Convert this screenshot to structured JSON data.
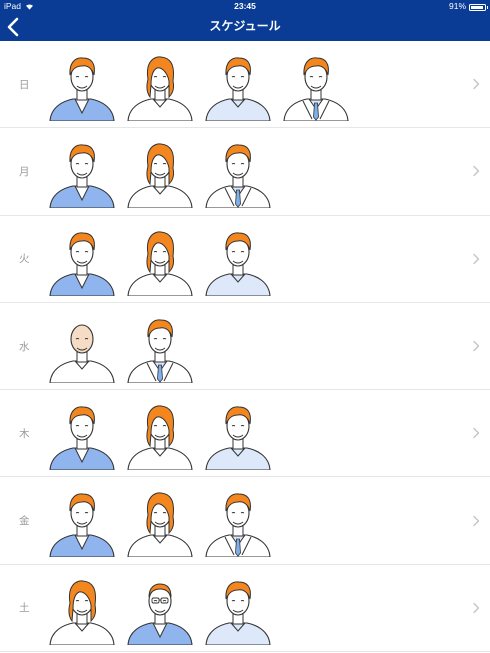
{
  "status_bar": {
    "device": "iPad",
    "time": "23:45",
    "battery": "91%",
    "battery_level": 0.91
  },
  "nav": {
    "title": "スケジュール",
    "back_icon": "chevron-left-icon"
  },
  "colors": {
    "nav_bg": "#0a3c96",
    "hair": "#f3861f",
    "bald": "#f6dcc4",
    "skin": "#ffffff",
    "suit_blue": "#8fb4ee",
    "shirt_light": "#dde9fa",
    "tie": "#7fb0ea"
  },
  "days": [
    {
      "label": "日",
      "people": [
        "man-blue-suit",
        "woman-white",
        "man-shirt",
        "man-labcoat"
      ]
    },
    {
      "label": "月",
      "people": [
        "man-blue-suit",
        "woman-white",
        "man-labcoat"
      ]
    },
    {
      "label": "火",
      "people": [
        "man-blue-suit",
        "woman-white",
        "man-shirt"
      ]
    },
    {
      "label": "水",
      "people": [
        "bald-white",
        "man-labcoat-dark"
      ]
    },
    {
      "label": "木",
      "people": [
        "man-blue-suit",
        "woman-white",
        "man-shirt"
      ]
    },
    {
      "label": "金",
      "people": [
        "man-blue-suit",
        "woman-white",
        "man-labcoat"
      ]
    },
    {
      "label": "土",
      "people": [
        "woman-white",
        "glasses-blue-suit",
        "man-shirt"
      ]
    }
  ]
}
